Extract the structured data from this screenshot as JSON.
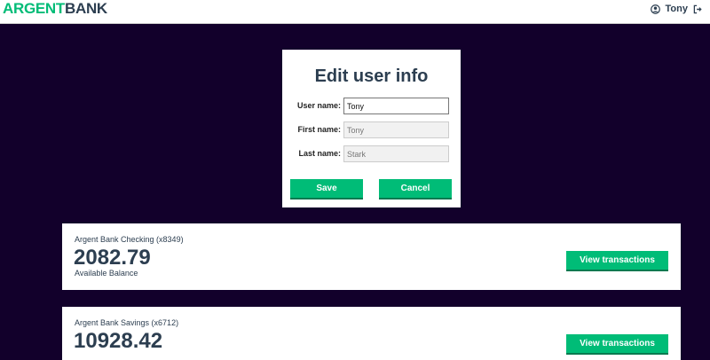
{
  "nav": {
    "logo_part1": "ARGENT",
    "logo_part2": "BANK",
    "user_name": "Tony",
    "user_icon": "user-circle-icon",
    "signout_icon": "sign-out-icon"
  },
  "edit_form": {
    "title": "Edit user info",
    "username_label": "User name:",
    "username_value": "Tony",
    "firstname_label": "First name:",
    "firstname_value": "Tony",
    "lastname_label": "Last name:",
    "lastname_value": "Stark",
    "save_label": "Save",
    "cancel_label": "Cancel"
  },
  "accounts": [
    {
      "title": "Argent Bank Checking (x8349)",
      "amount": "2082.79",
      "description": "Available Balance",
      "button": "View transactions"
    },
    {
      "title": "Argent Bank Savings (x6712)",
      "amount": "10928.42",
      "button": "View transactions"
    }
  ],
  "colors": {
    "background": "#12002b",
    "accent": "#00bc77",
    "text": "#2c3e50"
  }
}
